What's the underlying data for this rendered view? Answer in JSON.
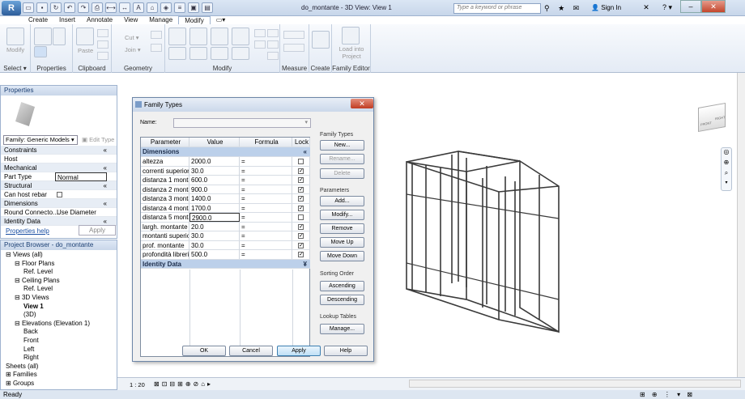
{
  "app": {
    "title": "do_montante - 3D View: View 1",
    "logo": "R",
    "search_placeholder": "Type a keyword or phrase",
    "signin": "Sign In",
    "help": "?"
  },
  "tabs": [
    "Create",
    "Insert",
    "Annotate",
    "View",
    "Manage",
    "Modify"
  ],
  "ribbon": {
    "modify": "Modify",
    "select": "Select",
    "properties": "Properties",
    "paste": "Paste",
    "clipboard": "Clipboard",
    "cut": "Cut",
    "join": "Join",
    "geometry": "Geometry",
    "modify_panel": "Modify",
    "measure": "Measure",
    "create": "Create",
    "load_into_project": "Load into Project",
    "family_editor": "Family Editor"
  },
  "properties": {
    "header": "Properties",
    "family": "Family: Generic Models",
    "edit_type": "Edit Type",
    "rows": [
      {
        "cat": true,
        "label": "Constraints"
      },
      {
        "label": "Host",
        "value": ""
      },
      {
        "cat": true,
        "label": "Mechanical"
      },
      {
        "label": "Part Type",
        "value": "Normal"
      },
      {
        "cat": true,
        "label": "Structural"
      },
      {
        "label": "Can host rebar",
        "value": ""
      },
      {
        "cat": true,
        "label": "Dimensions"
      },
      {
        "label": "Round Connecto...",
        "value": "Use Diameter"
      },
      {
        "cat": true,
        "label": "Identity Data"
      }
    ],
    "help": "Properties help",
    "apply": "Apply"
  },
  "browser": {
    "header": "Project Browser - do_montante",
    "items": [
      {
        "t": "Views (all)",
        "l": 0,
        "x": "⊟"
      },
      {
        "t": "Floor Plans",
        "l": 1,
        "x": "⊟"
      },
      {
        "t": "Ref. Level",
        "l": 2,
        "x": ""
      },
      {
        "t": "Ceiling Plans",
        "l": 1,
        "x": "⊟"
      },
      {
        "t": "Ref. Level",
        "l": 2,
        "x": ""
      },
      {
        "t": "3D Views",
        "l": 1,
        "x": "⊟"
      },
      {
        "t": "View 1",
        "l": 2,
        "x": "",
        "b": true
      },
      {
        "t": "(3D)",
        "l": 2,
        "x": ""
      },
      {
        "t": "Elevations (Elevation 1)",
        "l": 1,
        "x": "⊟"
      },
      {
        "t": "Back",
        "l": 2,
        "x": ""
      },
      {
        "t": "Front",
        "l": 2,
        "x": ""
      },
      {
        "t": "Left",
        "l": 2,
        "x": ""
      },
      {
        "t": "Right",
        "l": 2,
        "x": ""
      },
      {
        "t": "Sheets (all)",
        "l": 0,
        "x": ""
      },
      {
        "t": "Families",
        "l": 0,
        "x": "⊞"
      },
      {
        "t": "Groups",
        "l": 0,
        "x": "⊞"
      }
    ]
  },
  "dialog": {
    "title": "Family Types",
    "name_label": "Name:",
    "cols": [
      "Parameter",
      "Value",
      "Formula",
      "Lock"
    ],
    "section1": "Dimensions",
    "section2": "Identity Data",
    "rows": [
      {
        "p": "altezza",
        "v": "2000.0",
        "f": "=",
        "lock": false
      },
      {
        "p": "correnti superiori",
        "v": "30.0",
        "f": "=",
        "lock": true
      },
      {
        "p": "distanza 1 montan",
        "v": "600.0",
        "f": "=",
        "lock": true
      },
      {
        "p": "distanza 2 montan",
        "v": "900.0",
        "f": "=",
        "lock": true
      },
      {
        "p": "distanza 3 montan",
        "v": "1400.0",
        "f": "=",
        "lock": true
      },
      {
        "p": "distanza 4 montan",
        "v": "1700.0",
        "f": "=",
        "lock": true
      },
      {
        "p": "distanza 5 montan",
        "v": "2900.0",
        "f": "=",
        "lock": false
      },
      {
        "p": "largh. montante",
        "v": "20.0",
        "f": "=",
        "lock": true
      },
      {
        "p": "montanti superiori",
        "v": "30.0",
        "f": "=",
        "lock": true
      },
      {
        "p": "prof. montante",
        "v": "30.0",
        "f": "=",
        "lock": true
      },
      {
        "p": "profondità libreria",
        "v": "500.0",
        "f": "=",
        "lock": true
      }
    ],
    "family_types": "Family Types",
    "new": "New...",
    "rename": "Rename...",
    "delete": "Delete",
    "parameters": "Parameters",
    "add": "Add...",
    "modify": "Modify...",
    "remove": "Remove",
    "move_up": "Move Up",
    "move_down": "Move Down",
    "sorting": "Sorting Order",
    "ascending": "Ascending",
    "descending": "Descending",
    "lookup": "Lookup Tables",
    "manage": "Manage...",
    "ok": "OK",
    "cancel": "Cancel",
    "apply": "Apply",
    "help": "Help"
  },
  "viewbar": {
    "scale": "1 : 20"
  },
  "status": "Ready",
  "viewcube": {
    "front": "FRONT",
    "right": "RIGHT"
  }
}
